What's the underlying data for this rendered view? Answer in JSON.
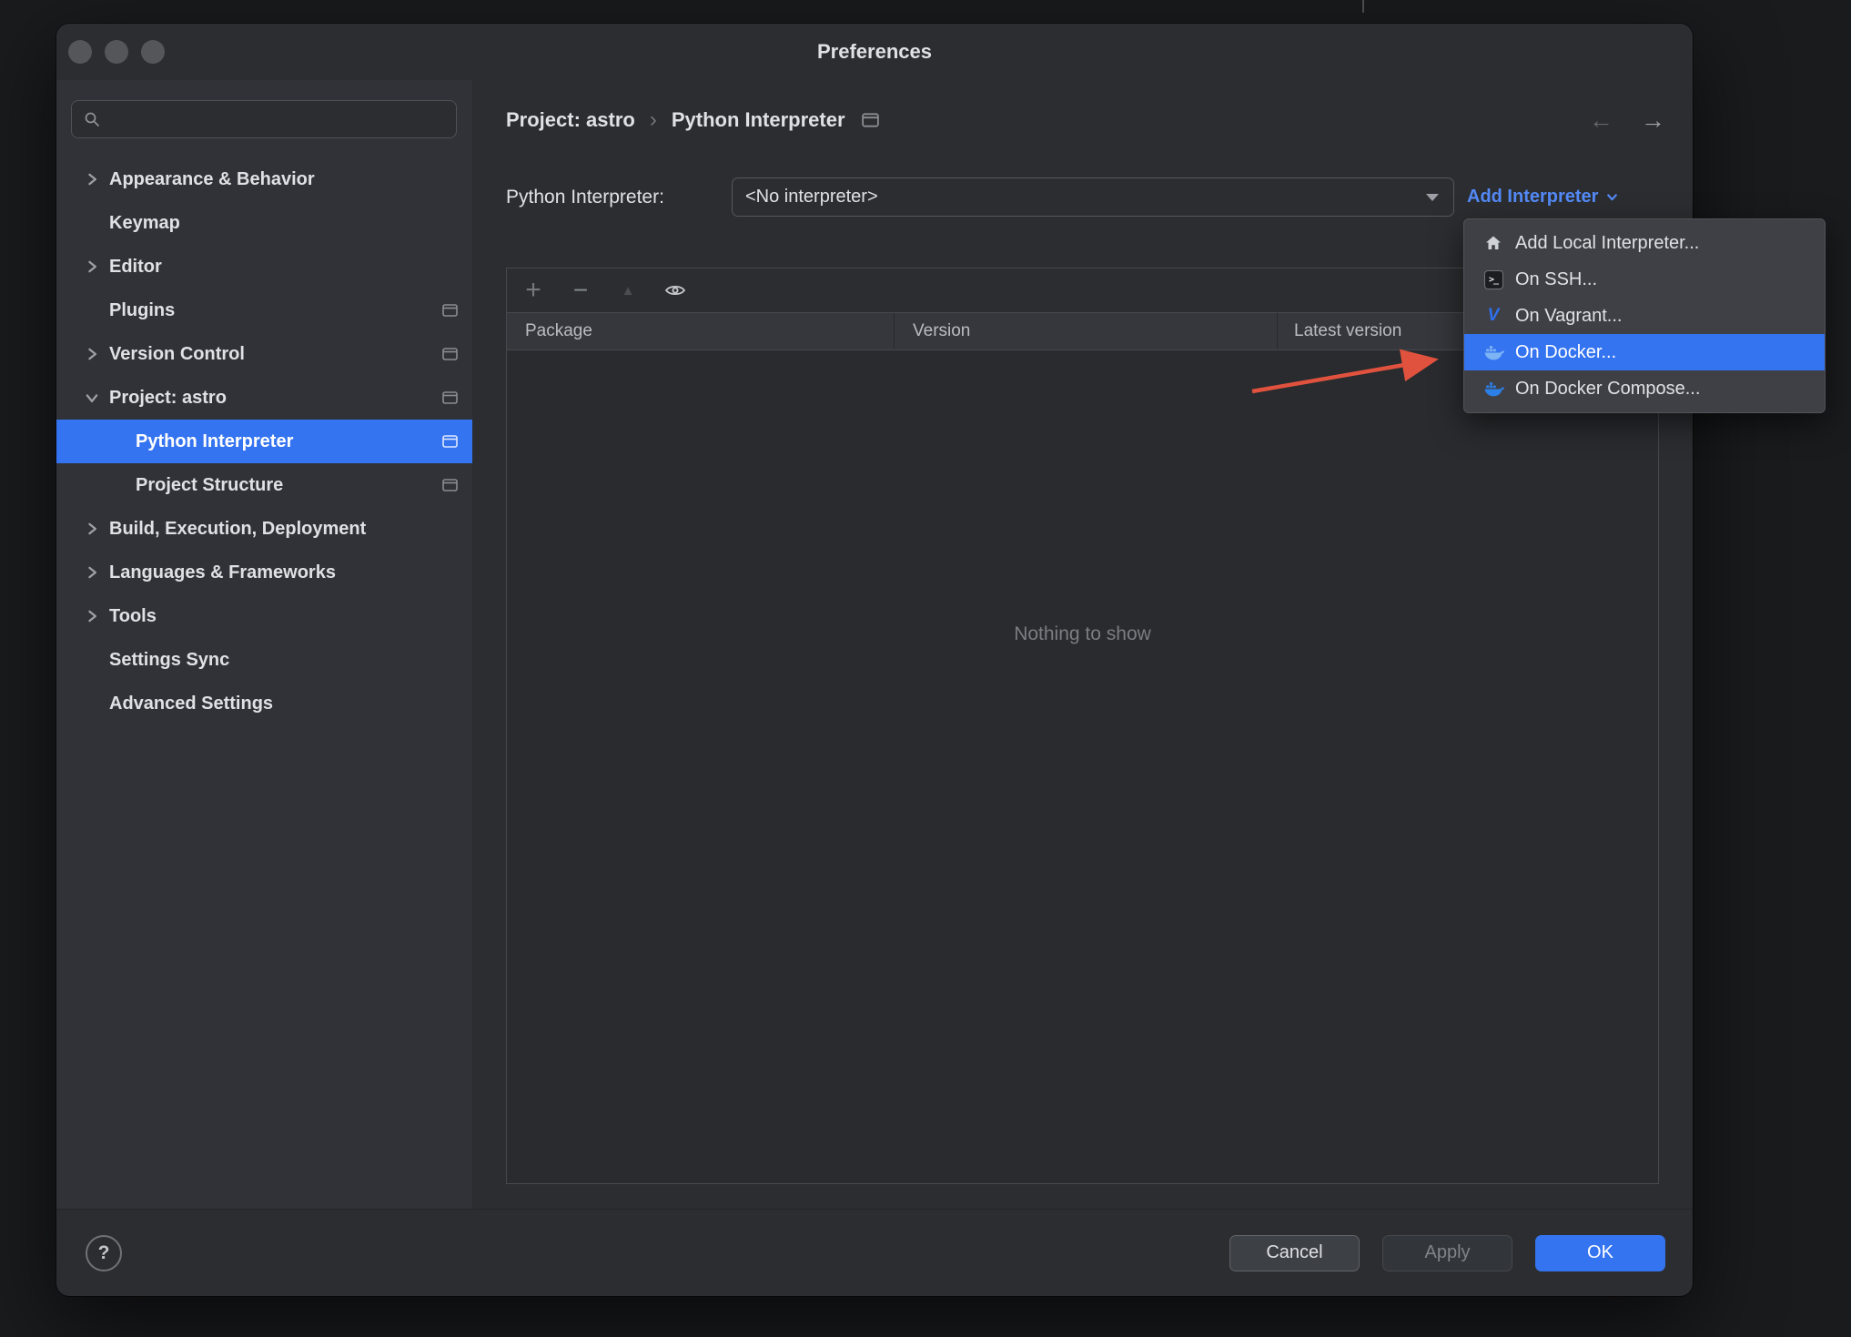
{
  "window": {
    "title": "Preferences"
  },
  "sidebar": {
    "search": {
      "placeholder": ""
    },
    "items": [
      {
        "label": "Appearance & Behavior",
        "state": "collapsed"
      },
      {
        "label": "Keymap"
      },
      {
        "label": "Editor",
        "state": "collapsed"
      },
      {
        "label": "Plugins",
        "badge": "window-icon"
      },
      {
        "label": "Version Control",
        "state": "collapsed",
        "badge": "window-icon"
      },
      {
        "label": "Project: astro",
        "state": "expanded",
        "badge": "window-icon"
      },
      {
        "label": "Python Interpreter",
        "child": true,
        "selected": true,
        "badge": "window-icon"
      },
      {
        "label": "Project Structure",
        "child": true,
        "badge": "window-icon"
      },
      {
        "label": "Build, Execution, Deployment",
        "state": "collapsed"
      },
      {
        "label": "Languages & Frameworks",
        "state": "collapsed"
      },
      {
        "label": "Tools",
        "state": "collapsed"
      },
      {
        "label": "Settings Sync"
      },
      {
        "label": "Advanced Settings"
      }
    ]
  },
  "breadcrumb": {
    "items": [
      "Project: astro",
      "Python Interpreter"
    ],
    "separator": "›"
  },
  "main": {
    "interpreter_label": "Python Interpreter:",
    "interpreter_value": "<No interpreter>",
    "add_interpreter_label": "Add Interpreter",
    "table": {
      "columns": [
        "Package",
        "Version",
        "Latest version"
      ],
      "empty_text": "Nothing to show"
    }
  },
  "menu": {
    "items": [
      {
        "label": "Add Local Interpreter...",
        "icon": "home-icon"
      },
      {
        "label": "On SSH...",
        "icon": "ssh-terminal-icon"
      },
      {
        "label": "On Vagrant...",
        "icon": "vagrant-icon"
      },
      {
        "label": "On Docker...",
        "icon": "docker-icon",
        "highlighted": true
      },
      {
        "label": "On Docker Compose...",
        "icon": "docker-compose-icon"
      }
    ]
  },
  "footer": {
    "help_label": "?",
    "buttons": [
      {
        "label": "Cancel"
      },
      {
        "label": "Apply",
        "disabled": true
      },
      {
        "label": "OK",
        "primary": true
      }
    ]
  },
  "colors": {
    "accent": "#3574F0",
    "link": "#548AF7",
    "selection": "#3574F0",
    "annotation_arrow": "#E0523E"
  }
}
